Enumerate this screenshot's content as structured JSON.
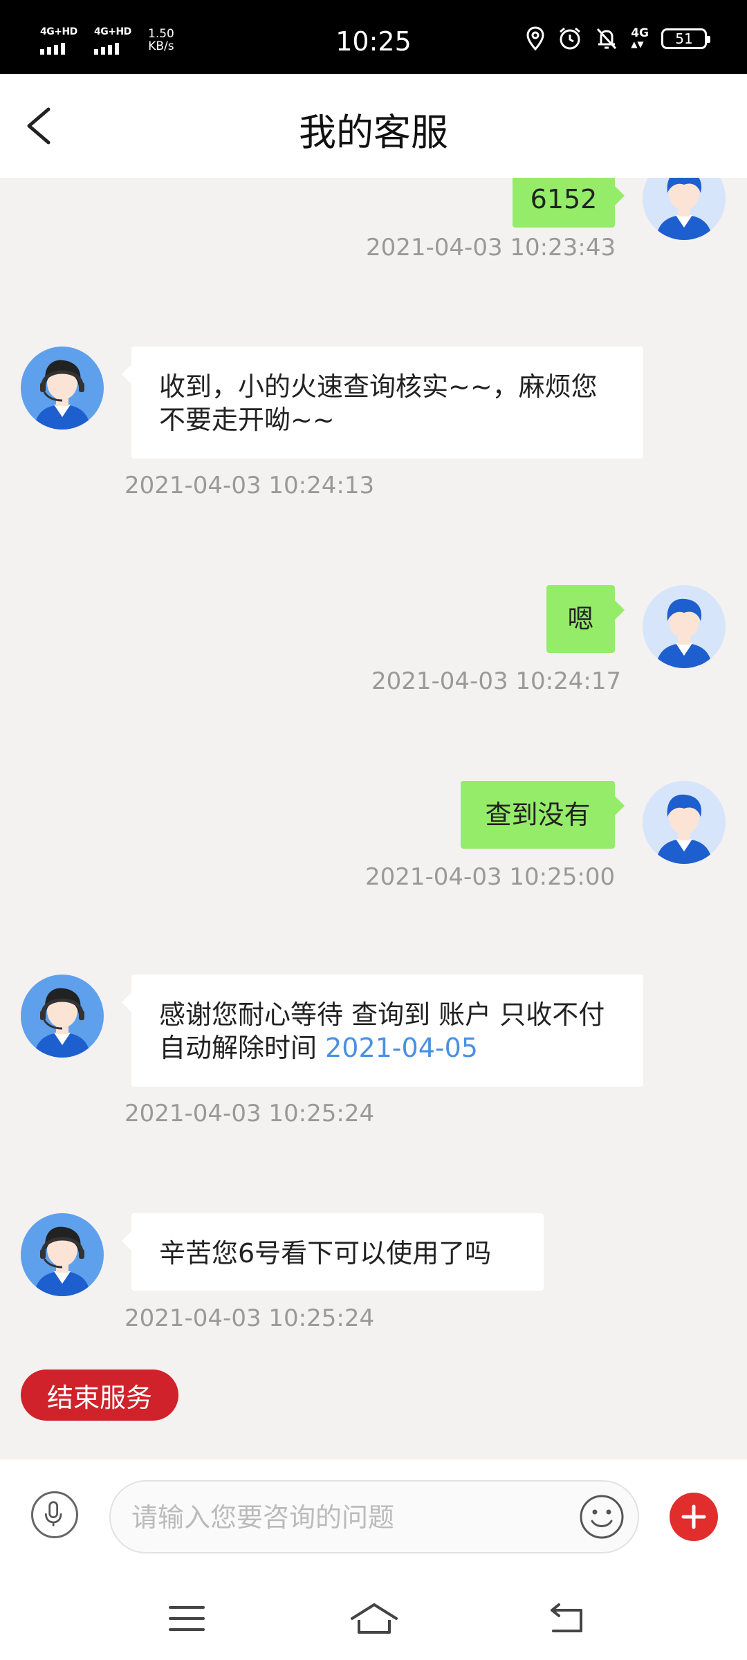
{
  "status_bar": {
    "signal1": "4G+HD",
    "signal2": "4G+HD",
    "speed_value": "1.50",
    "speed_unit": "KB/s",
    "time": "10:25",
    "network": "4G",
    "battery": "51"
  },
  "header": {
    "title": "我的客服"
  },
  "messages": [
    {
      "sender": "user",
      "text": "6152",
      "time": "2021-04-03 10:23:43"
    },
    {
      "sender": "agent",
      "text": "收到，小的火速查询核实~~，麻烦您不要走开呦~~",
      "time": "2021-04-03 10:24:13"
    },
    {
      "sender": "user",
      "text": "嗯",
      "time": "2021-04-03 10:24:17"
    },
    {
      "sender": "user",
      "text": "查到没有",
      "time": "2021-04-03 10:25:00"
    },
    {
      "sender": "agent",
      "text": "感谢您耐心等待 查询到 账户 只收不付 自动解除时间 ",
      "link": "2021-04-05",
      "time": "2021-04-03 10:25:24"
    },
    {
      "sender": "agent",
      "text": "辛苦您6号看下可以使用了吗",
      "time": "2021-04-03 10:25:24"
    }
  ],
  "end_service_label": "结束服务",
  "input": {
    "placeholder": "请输入您要咨询的问题",
    "value": ""
  },
  "icons": {
    "back": "back-arrow-icon",
    "voice": "microphone-icon",
    "emoji": "smiley-icon",
    "add": "plus-icon",
    "nav_menu": "menu-icon",
    "nav_home": "home-icon",
    "nav_back": "return-icon"
  },
  "colors": {
    "user_bubble": "#95ec69",
    "agent_bubble": "#ffffff",
    "end_button": "#d0222a",
    "add_button": "#e22d2d",
    "link": "#4a90e2"
  }
}
